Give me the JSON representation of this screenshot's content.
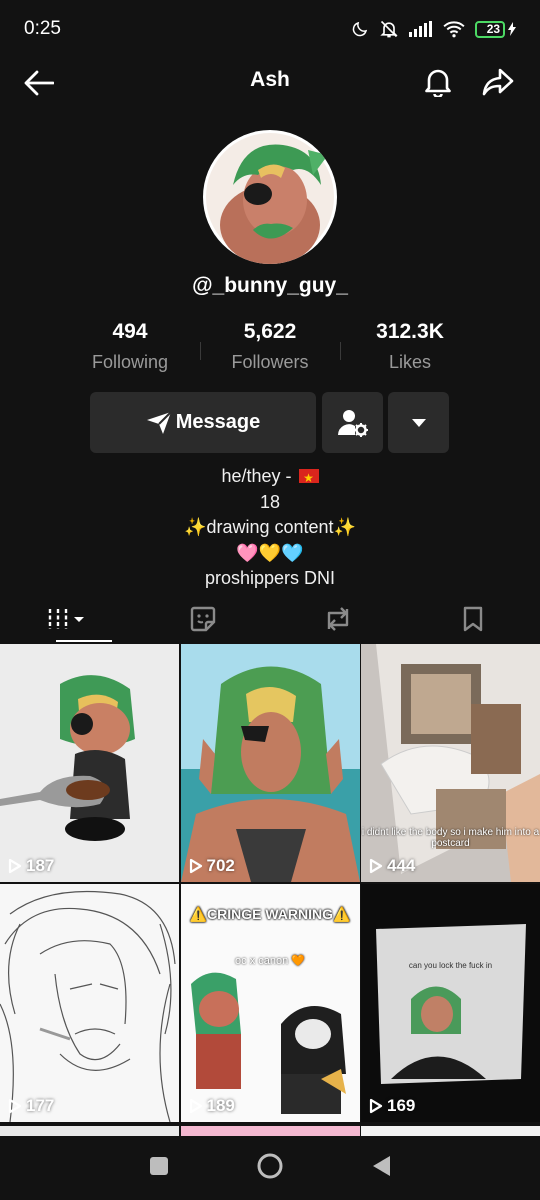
{
  "status_bar": {
    "time": "0:25",
    "battery": "23"
  },
  "header": {
    "title": "Ash"
  },
  "profile": {
    "username": "@_bunny_guy_"
  },
  "stats": [
    {
      "value": "494",
      "label": "Following"
    },
    {
      "value": "5,622",
      "label": "Followers"
    },
    {
      "value": "312.3K",
      "label": "Likes"
    }
  ],
  "actions": {
    "message_label": "Message"
  },
  "bio": {
    "line1": "he/they - ",
    "line2": "18",
    "line3": "✨drawing content✨",
    "line4": "🩷💛🩵",
    "line5": "proshippers DNI"
  },
  "tabs": [
    "videos",
    "reposts-sticker",
    "reposts",
    "favorites"
  ],
  "videos": [
    {
      "views": "187"
    },
    {
      "views": "702"
    },
    {
      "views": "444",
      "caption": "i didnt like the body so i make him into a postcard"
    },
    {
      "views": "177"
    },
    {
      "views": "189",
      "caption_top": "⚠️CRINGE WARNING⚠️",
      "caption_sub": "oc x canon 🧡"
    },
    {
      "views": "169",
      "caption": "can you lock the fuck in"
    }
  ],
  "colors": {
    "background": "#121212",
    "button": "#2b2b2b",
    "secondary_text": "#9a9a9a",
    "battery": "#4cd964"
  }
}
